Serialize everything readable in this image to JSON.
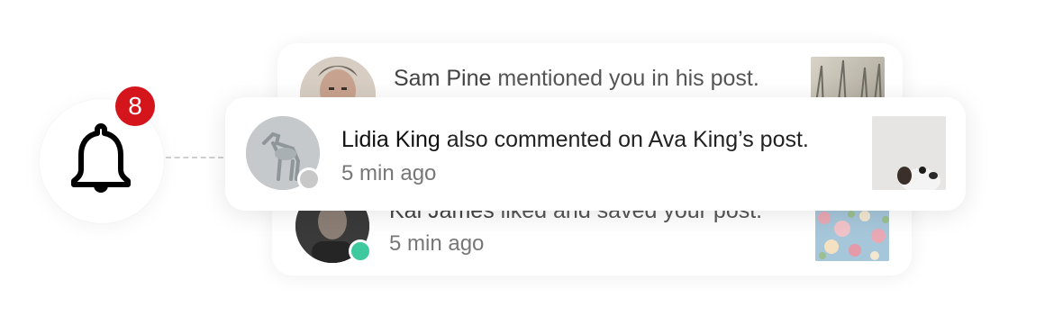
{
  "bell": {
    "icon": "bell-icon",
    "badge_count": "8",
    "badge_color": "#d4151c"
  },
  "notifications": [
    {
      "name": "Sam Pine",
      "action": " mentioned you in his post.",
      "time": ""
    },
    {
      "name": "Lidia King",
      "action": " also commented on Ava King’s post.",
      "time": "5 min ago",
      "status_color": "#c8c8c8"
    },
    {
      "name": "Kai James",
      "action": " liked and saved your post.",
      "time": "5 min ago",
      "status_color": "#3fc99f"
    }
  ]
}
